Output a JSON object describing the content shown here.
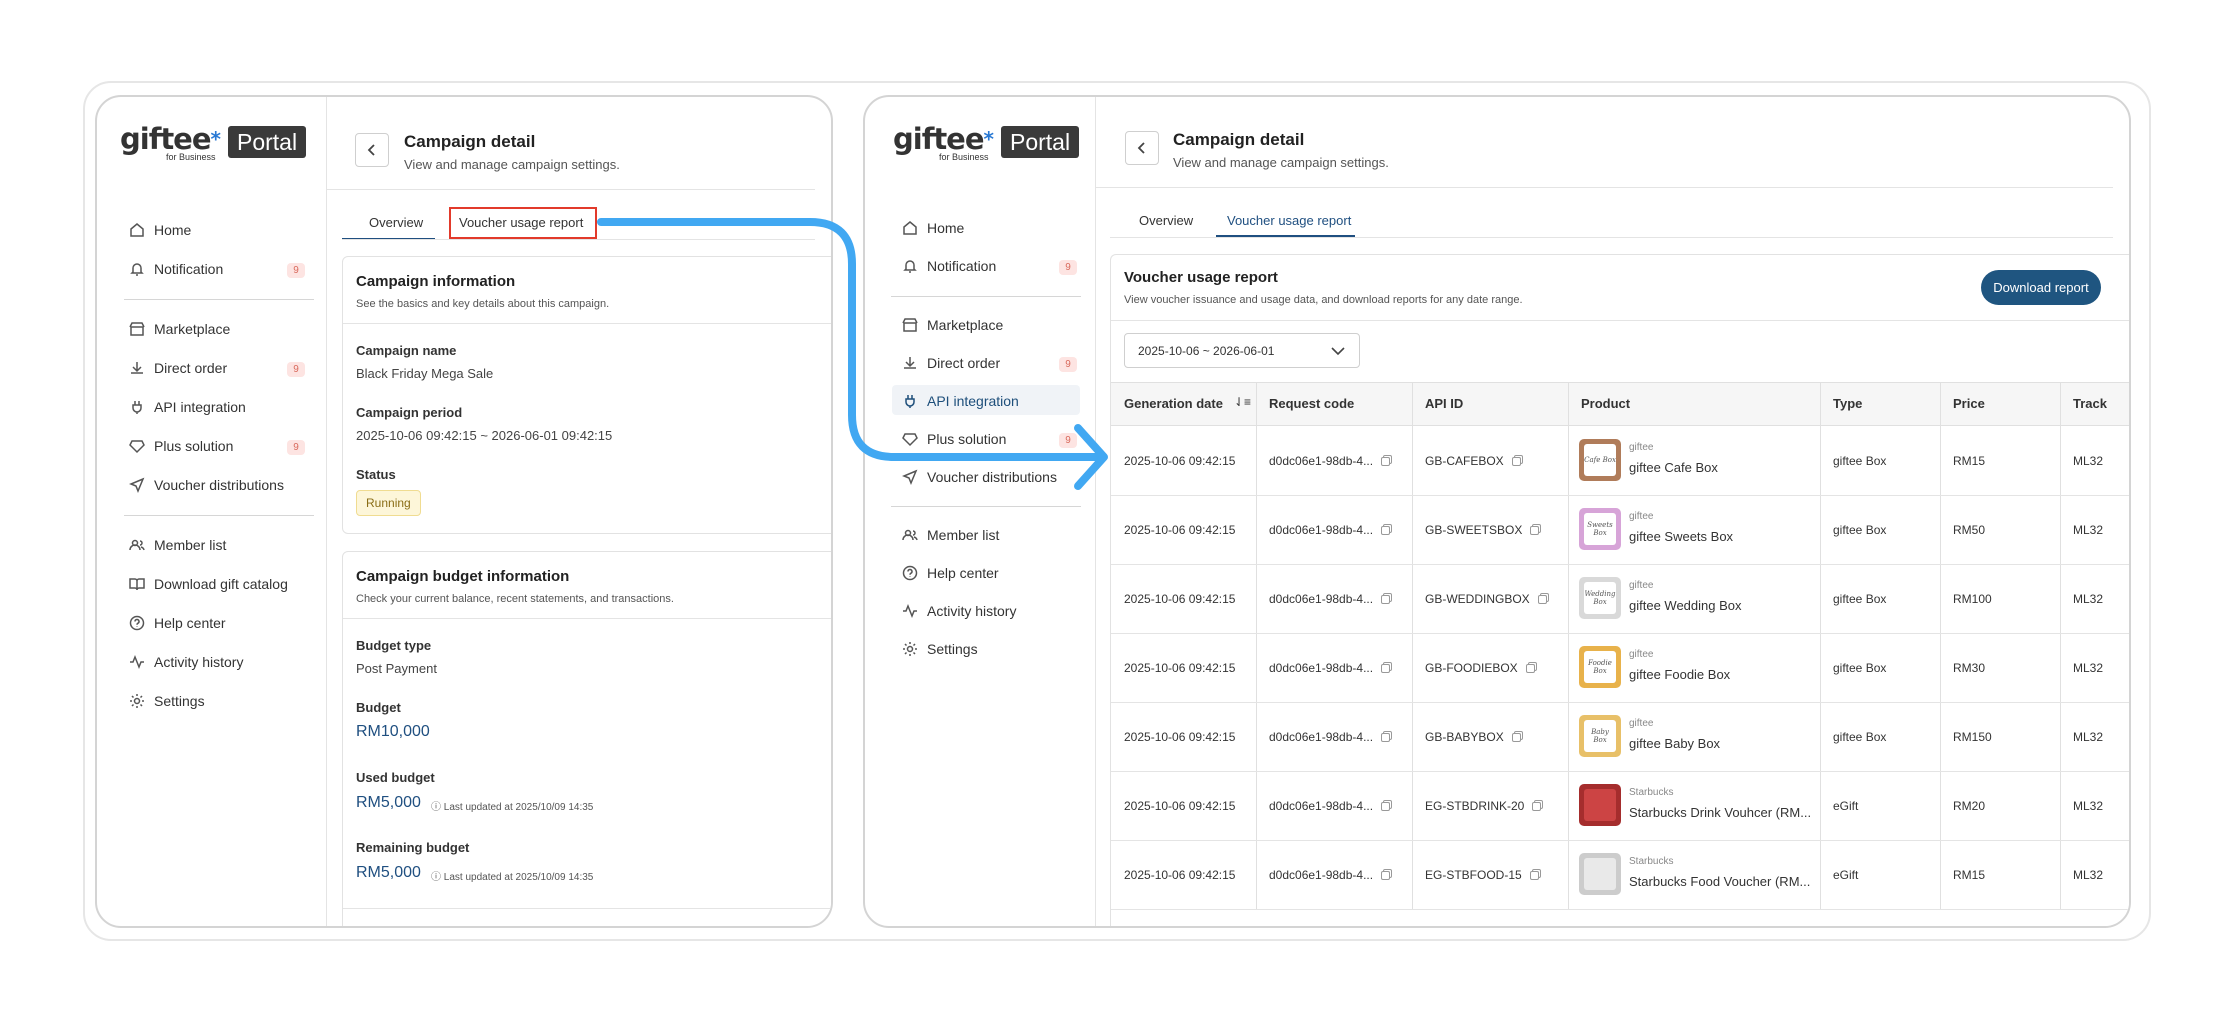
{
  "logo": {
    "brand": "giftee",
    "star": "*",
    "tagline": "for Business",
    "portal": "Portal"
  },
  "nav": {
    "home": "Home",
    "notification": "Notification",
    "notification_count": "9",
    "marketplace": "Marketplace",
    "direct_order": "Direct order",
    "direct_order_count": "9",
    "api_integration": "API integration",
    "plus_solution": "Plus solution",
    "plus_solution_count": "9",
    "voucher_distributions": "Voucher distributions",
    "member_list": "Member list",
    "download_gift_catalog": "Download gift catalog",
    "help_center": "Help center",
    "activity_history": "Activity history",
    "settings": "Settings"
  },
  "header": {
    "title": "Campaign detail",
    "subtitle": "View and manage campaign settings."
  },
  "tabs": {
    "overview": "Overview",
    "voucher_usage_report": "Voucher usage report"
  },
  "campaign_info": {
    "title": "Campaign information",
    "subtitle": "See the basics and key details about this campaign.",
    "name_label": "Campaign name",
    "name": "Black Friday Mega Sale",
    "period_label": "Campaign period",
    "period": "2025-10-06 09:42:15 ~ 2026-06-01 09:42:15",
    "status_label": "Status",
    "status": "Running"
  },
  "budget_info": {
    "title": "Campaign budget information",
    "subtitle": "Check your current balance, recent statements, and transactions.",
    "type_label": "Budget type",
    "type": "Post Payment",
    "budget_label": "Budget",
    "budget": "RM10,000",
    "used_label": "Used budget",
    "used": "RM5,000",
    "used_note": "Last updated at 2025/10/09 14:35",
    "remaining_label": "Remaining budget",
    "remaining": "RM5,000",
    "remaining_note": "Last updated at 2025/10/09 14:35"
  },
  "report": {
    "title": "Voucher usage report",
    "subtitle": "View voucher issuance and usage data, and download reports for any date range.",
    "download": "Download report",
    "date_range": "2025-10-06 ~ 2026-06-01",
    "columns": [
      "Generation date",
      "Request code",
      "API ID",
      "Product",
      "Type",
      "Price",
      "Track"
    ],
    "rows": [
      {
        "date": "2025-10-06 09:42:15",
        "code": "d0dc06e1-98db-4...",
        "api": "GB-CAFEBOX",
        "brand": "giftee",
        "product": "giftee Cafe Box",
        "thumb_text": "Cafe Box",
        "type": "giftee Box",
        "price": "RM15",
        "track": "ML32"
      },
      {
        "date": "2025-10-06 09:42:15",
        "code": "d0dc06e1-98db-4...",
        "api": "GB-SWEETSBOX",
        "brand": "giftee",
        "product": "giftee Sweets Box",
        "thumb_text": "Sweets Box",
        "type": "giftee Box",
        "price": "RM50",
        "track": "ML32"
      },
      {
        "date": "2025-10-06 09:42:15",
        "code": "d0dc06e1-98db-4...",
        "api": "GB-WEDDINGBOX",
        "brand": "giftee",
        "product": "giftee Wedding Box",
        "thumb_text": "Wedding Box",
        "type": "giftee Box",
        "price": "RM100",
        "track": "ML32"
      },
      {
        "date": "2025-10-06 09:42:15",
        "code": "d0dc06e1-98db-4...",
        "api": "GB-FOODIEBOX",
        "brand": "giftee",
        "product": "giftee Foodie Box",
        "thumb_text": "Foodie Box",
        "type": "giftee Box",
        "price": "RM30",
        "track": "ML32"
      },
      {
        "date": "2025-10-06 09:42:15",
        "code": "d0dc06e1-98db-4...",
        "api": "GB-BABYBOX",
        "brand": "giftee",
        "product": "giftee Baby Box",
        "thumb_text": "Baby Box",
        "type": "giftee Box",
        "price": "RM150",
        "track": "ML32"
      },
      {
        "date": "2025-10-06 09:42:15",
        "code": "d0dc06e1-98db-4...",
        "api": "EG-STBDRINK-20",
        "brand": "Starbucks",
        "product": "Starbucks Drink Vouhcer (RM...",
        "thumb_text": "",
        "type": "eGift",
        "price": "RM20",
        "track": "ML32"
      },
      {
        "date": "2025-10-06 09:42:15",
        "code": "d0dc06e1-98db-4...",
        "api": "EG-STBFOOD-15",
        "brand": "Starbucks",
        "product": "Starbucks Food Voucher (RM...",
        "thumb_text": "",
        "type": "eGift",
        "price": "RM15",
        "track": "ML32"
      }
    ]
  },
  "colors": {
    "accent": "#1f4f80",
    "arrow": "#41a8f2",
    "highlight": "#e23a2b",
    "badge_bg": "#fde4e2",
    "status_bg": "#fdf6d9",
    "thumbs": [
      "#b07c5a",
      "#d7a4d8",
      "#d9d9d9",
      "#e8b24b",
      "#e8c068",
      "#a52d2d",
      "#cccccc"
    ]
  }
}
